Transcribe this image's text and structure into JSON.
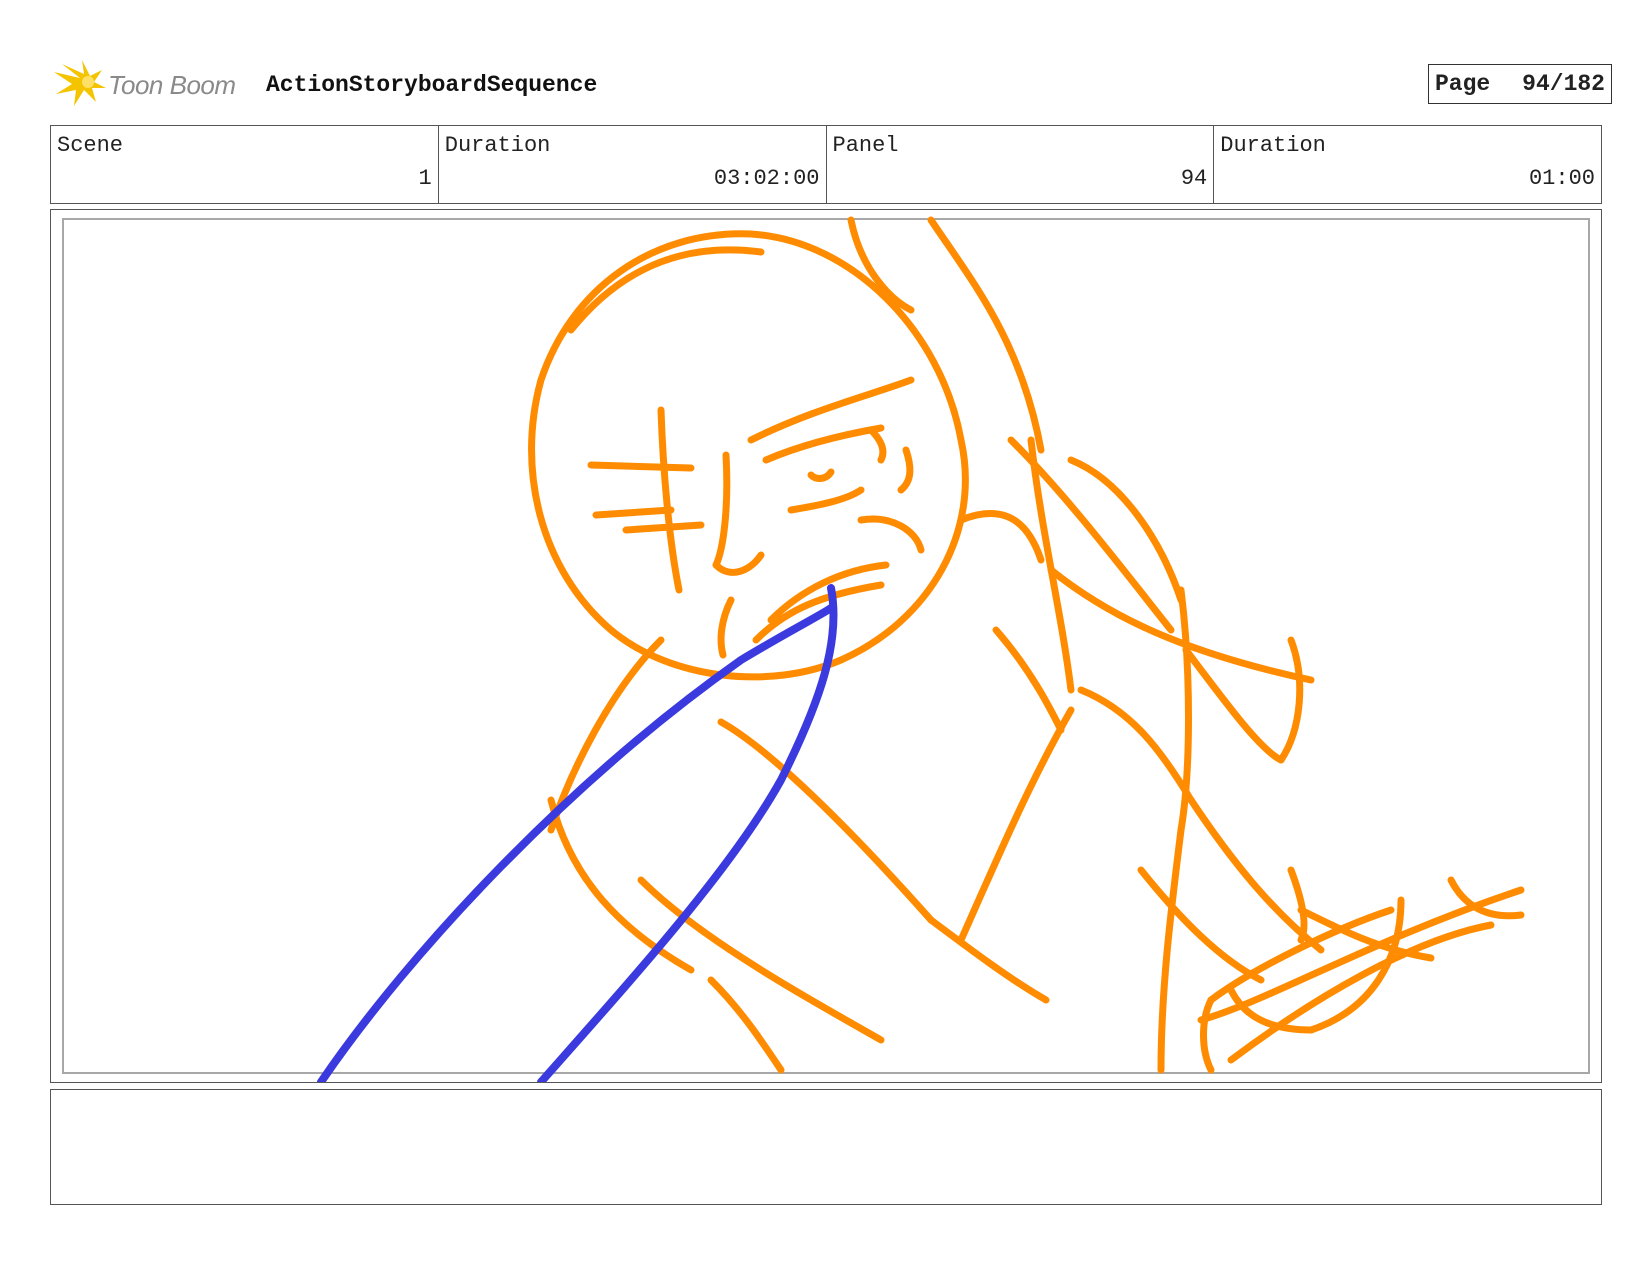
{
  "header": {
    "logo_text": "Toon Boom",
    "title": "ActionStoryboardSequence",
    "page_label": "Page",
    "page_value": "94/182"
  },
  "info": {
    "scene_label": "Scene",
    "scene_value": "1",
    "scene_duration_label": "Duration",
    "scene_duration_value": "03:02:00",
    "panel_label": "Panel",
    "panel_value": "94",
    "panel_duration_label": "Duration",
    "panel_duration_value": "01:00"
  },
  "colors": {
    "sketch_primary": "#ff8c00",
    "sketch_secondary": "#3a3adf",
    "logo_star": "#f5c400"
  },
  "notes": {
    "text": ""
  }
}
